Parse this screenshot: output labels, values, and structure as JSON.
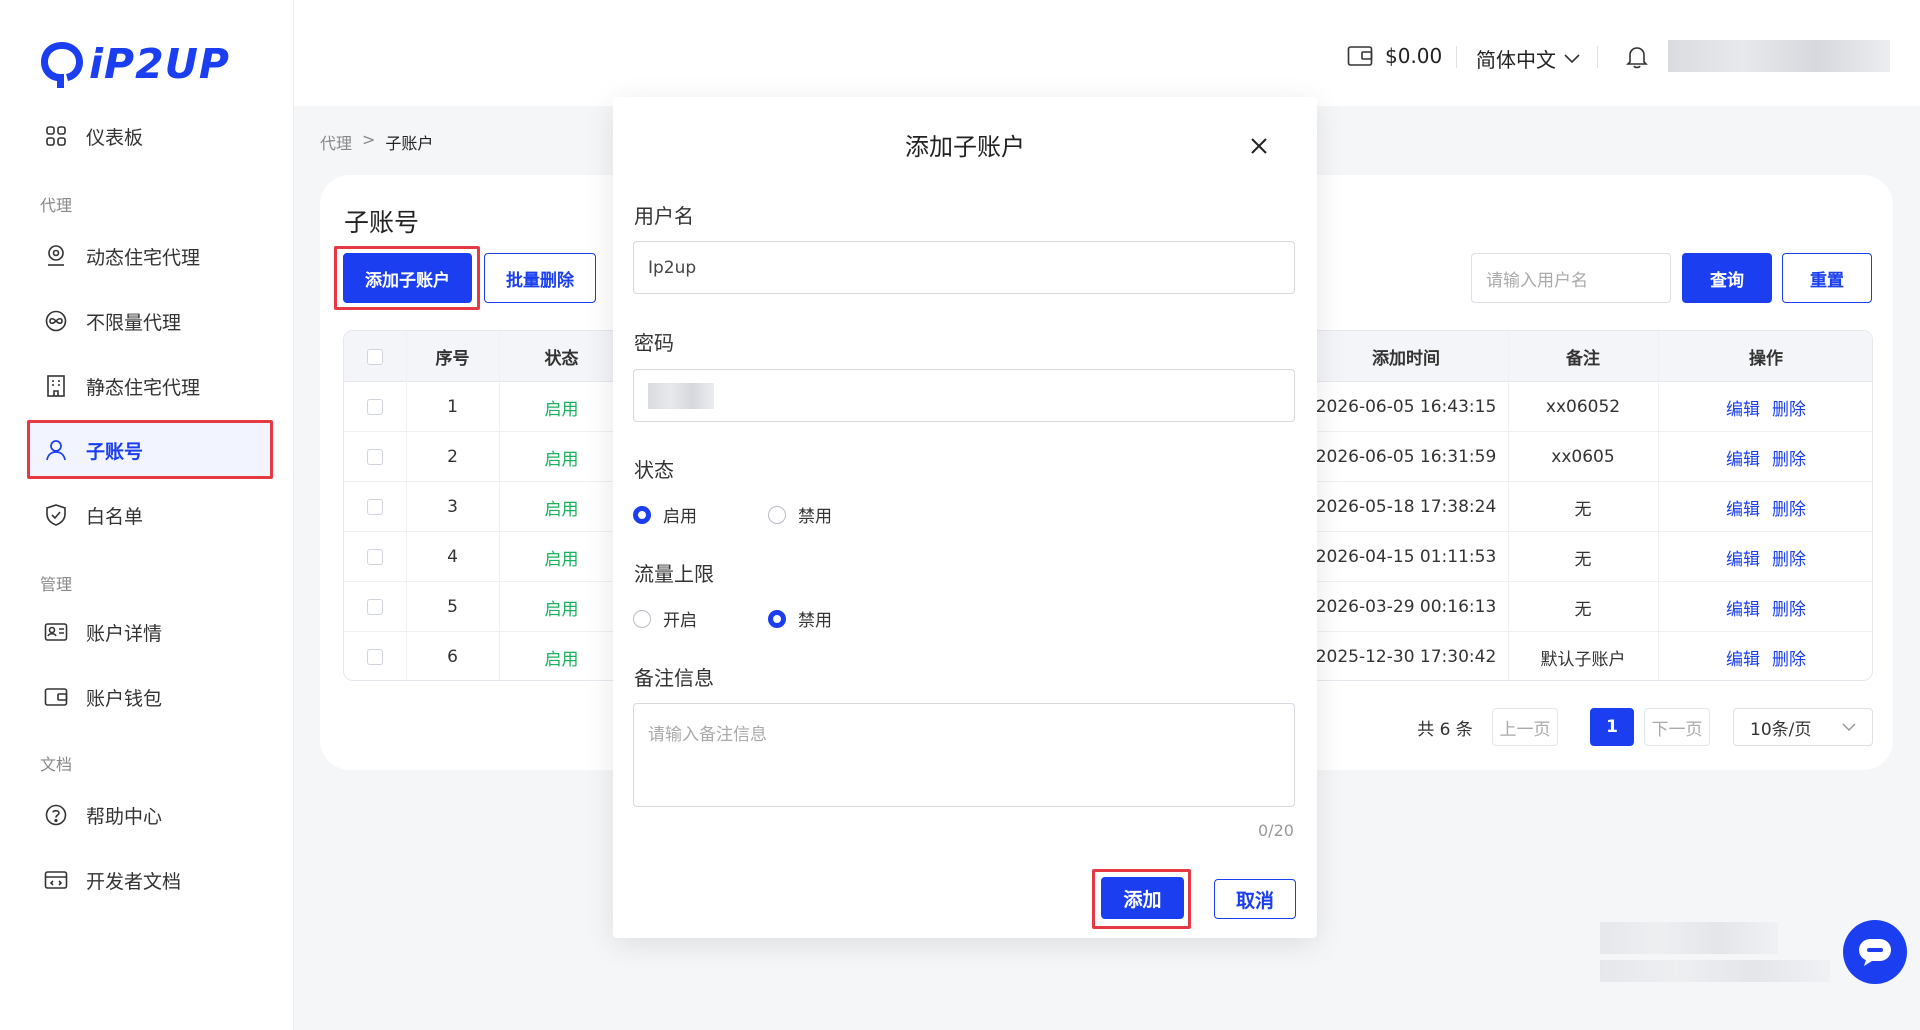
{
  "brand": {
    "name": "iP2UP",
    "color": "#1a3ef0"
  },
  "sidebar": {
    "dashboard": {
      "label": "仪表板",
      "icon": "dashboard-icon"
    },
    "section_proxy": "代理",
    "proxy_items": [
      {
        "label": "动态住宅代理",
        "icon": "location-pin-icon"
      },
      {
        "label": "不限量代理",
        "icon": "infinity-icon"
      },
      {
        "label": "静态住宅代理",
        "icon": "building-icon"
      },
      {
        "label": "子账号",
        "icon": "user-icon",
        "active": true
      },
      {
        "label": "白名单",
        "icon": "shield-icon"
      }
    ],
    "section_manage": "管理",
    "manage_items": [
      {
        "label": "账户详情",
        "icon": "id-card-icon"
      },
      {
        "label": "账户钱包",
        "icon": "wallet-icon"
      }
    ],
    "section_docs": "文档",
    "docs_items": [
      {
        "label": "帮助中心",
        "icon": "question-circle-icon"
      },
      {
        "label": "开发者文档",
        "icon": "code-doc-icon"
      }
    ]
  },
  "header": {
    "balance": "$0.00",
    "language": "简体中文"
  },
  "breadcrumb": {
    "parent": "代理",
    "separator": ">",
    "current": "子账户"
  },
  "main": {
    "title": "子账号",
    "add_button": "添加子账户",
    "batch_delete_button": "批量删除",
    "search_placeholder": "请输入用户名",
    "query_button": "查询",
    "reset_button": "重置",
    "columns": [
      "序号",
      "状态",
      "添加时间",
      "备注",
      "操作"
    ],
    "rows": [
      {
        "index": "1",
        "status": "启用",
        "added": "2026-06-05 16:43:15",
        "note": "xx06052"
      },
      {
        "index": "2",
        "status": "启用",
        "added": "2026-06-05 16:31:59",
        "note": "xx0605"
      },
      {
        "index": "3",
        "status": "启用",
        "added": "2026-05-18 17:38:24",
        "note": "无"
      },
      {
        "index": "4",
        "status": "启用",
        "added": "2026-04-15 01:11:53",
        "note": "无"
      },
      {
        "index": "5",
        "status": "启用",
        "added": "2026-03-29 00:16:13",
        "note": "无"
      },
      {
        "index": "6",
        "status": "启用",
        "added": "2025-12-30 17:30:42",
        "note": "默认子账户"
      }
    ],
    "edit_label": "编辑",
    "delete_label": "删除",
    "status_color": "#19b15d",
    "pagination": {
      "total": "共 6 条",
      "prev": "上一页",
      "current_page": "1",
      "next": "下一页",
      "page_size": "10条/页"
    }
  },
  "modal": {
    "title": "添加子账户",
    "username_label": "用户名",
    "username_value": "Ip2up",
    "password_label": "密码",
    "status_label": "状态",
    "status_options": [
      "启用",
      "禁用"
    ],
    "status_selected": "启用",
    "traffic_label": "流量上限",
    "traffic_options": [
      "开启",
      "禁用"
    ],
    "traffic_selected": "禁用",
    "note_label": "备注信息",
    "note_placeholder": "请输入备注信息",
    "note_counter": "0/20",
    "add_button": "添加",
    "cancel_button": "取消"
  },
  "highlight_color": "#e53a45"
}
